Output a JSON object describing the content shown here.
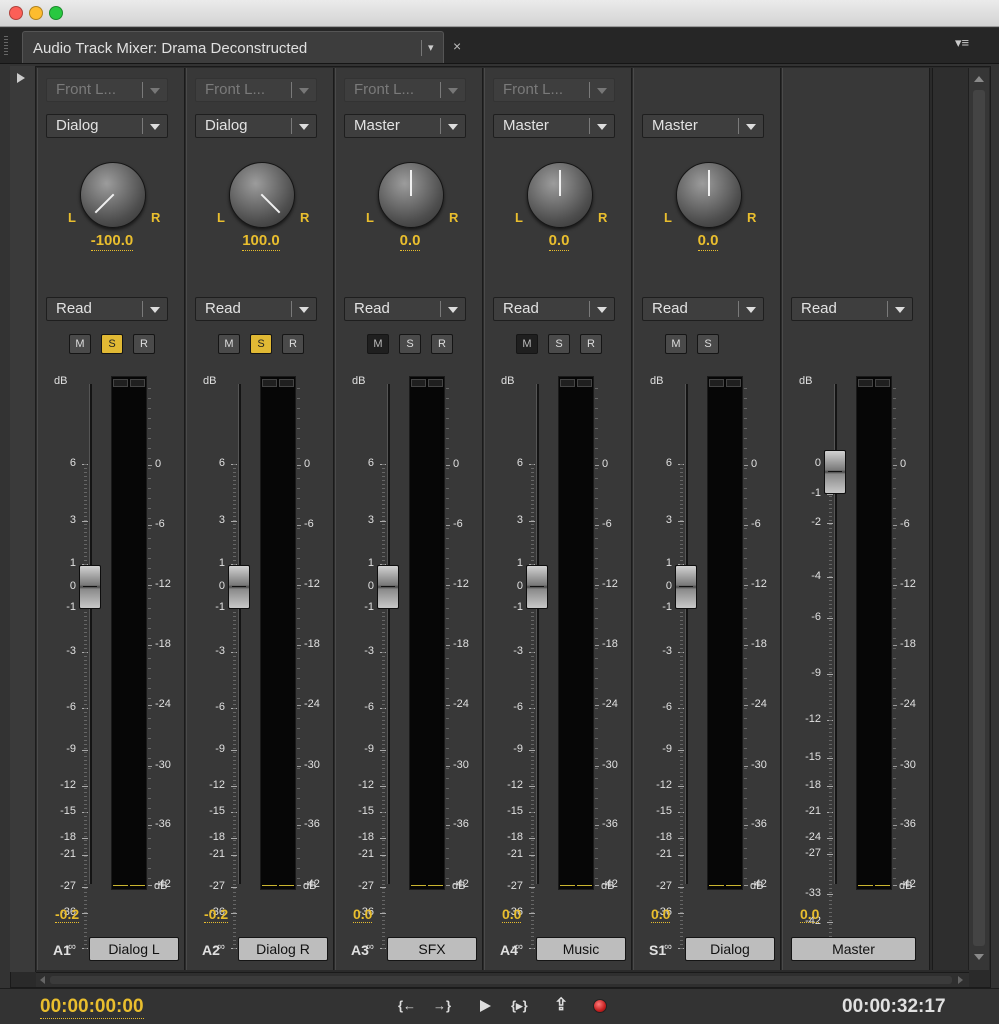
{
  "window": {
    "title": "Audio Track Mixer: Drama Deconstructed",
    "close_symbol": "×",
    "menu_symbol": "▾≡",
    "tab_menu_symbol": "▾"
  },
  "colors": {
    "accent": "#e9be2e",
    "solo_on": "#e1b934"
  },
  "channels": [
    {
      "input": "Front L...",
      "output": "Dialog",
      "pan": "-100.0",
      "pan_frac": 0,
      "auto": "Read",
      "mute": "M",
      "solo": "S",
      "rec": "R",
      "mute_state": "off",
      "solo_state": "on",
      "vol": "-0.2",
      "id": "A1",
      "name": "Dialog L"
    },
    {
      "input": "Front L...",
      "output": "Dialog",
      "pan": "100.0",
      "pan_frac": 1,
      "auto": "Read",
      "mute": "M",
      "solo": "S",
      "rec": "R",
      "mute_state": "off",
      "solo_state": "on",
      "vol": "-0.2",
      "id": "A2",
      "name": "Dialog R"
    },
    {
      "input": "Front L...",
      "output": "Master",
      "pan": "0.0",
      "pan_frac": 0.5,
      "auto": "Read",
      "mute": "M",
      "solo": "S",
      "rec": "R",
      "mute_state": "dark",
      "solo_state": "off",
      "vol": "0.0",
      "id": "A3",
      "name": "SFX"
    },
    {
      "input": "Front L...",
      "output": "Master",
      "pan": "0.0",
      "pan_frac": 0.5,
      "auto": "Read",
      "mute": "M",
      "solo": "S",
      "rec": "R",
      "mute_state": "dark",
      "solo_state": "off",
      "vol": "0.0",
      "id": "A4",
      "name": "Music"
    },
    {
      "output": "Master",
      "pan": "0.0",
      "pan_frac": 0.5,
      "auto": "Read",
      "mute": "M",
      "solo": "S",
      "mute_state": "off",
      "solo_state": "off",
      "vol": "0.0",
      "id": "S1",
      "name": "Dialog"
    },
    {
      "auto": "Read",
      "vol": "0.0",
      "name": "Master"
    }
  ],
  "pan_labels": {
    "left": "L",
    "right": "R"
  },
  "fader_scale_track": {
    "unit": "dB",
    "labels": [
      "6",
      "3",
      "1",
      "0",
      "-1",
      "-3",
      "-6",
      "-9",
      "-12",
      "-15",
      "-18",
      "-21",
      "-27",
      "-36",
      "-∞"
    ]
  },
  "fader_scale_master": {
    "unit": "dB",
    "labels": [
      "0",
      "-1",
      "-2",
      "-4",
      "-6",
      "-9",
      "-12",
      "-15",
      "-18",
      "-21",
      "-24",
      "-27",
      "-33",
      "-42",
      "-∞"
    ]
  },
  "meter_scale": {
    "unit": "dB",
    "labels": [
      "0",
      "-6",
      "-12",
      "-18",
      "-24",
      "-30",
      "-36",
      "-42"
    ]
  },
  "transport": {
    "current_time": "00:00:00:00",
    "duration": "00:00:32:17",
    "in_label": "{←",
    "out_label": "→}",
    "loop_label": "{▸}",
    "export_label": "⇪"
  }
}
